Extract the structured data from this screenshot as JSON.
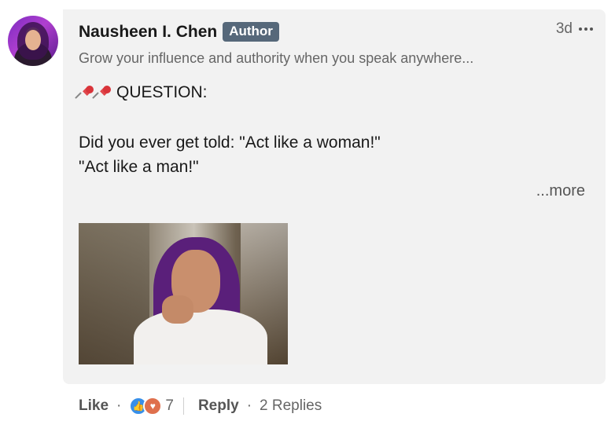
{
  "comment": {
    "author": {
      "name": "Nausheen I. Chen",
      "badge": "Author",
      "headline": "Grow your influence and authority when you speak anywhere..."
    },
    "timestamp": "3d",
    "body": {
      "line1": "QUESTION:",
      "line2": "Did you ever get told: \"Act like a woman!\"",
      "line3": "\"Act like a man!\"",
      "more_label": "...more"
    },
    "icons": {
      "menu": "more-options-icon",
      "pin": "pushpin-icon"
    }
  },
  "actions": {
    "like_label": "Like",
    "reaction_count": "7",
    "reply_label": "Reply",
    "replies_label": "2 Replies",
    "reaction_icons": [
      "like-reaction-icon",
      "love-reaction-icon"
    ]
  }
}
